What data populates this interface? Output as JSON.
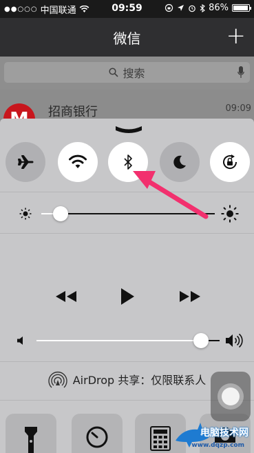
{
  "status_bar": {
    "carrier": "中国联通",
    "time": "09:59",
    "battery": "86%",
    "battery_level": 0.86
  },
  "wechat": {
    "title": "微信",
    "add_label": "+",
    "search_placeholder": "搜索",
    "chat_name": "招商银行",
    "chat_time": "09:09"
  },
  "control_center": {
    "toggles": [
      {
        "name": "airplane-mode",
        "icon": "airplane-icon",
        "on": false
      },
      {
        "name": "wifi",
        "icon": "wifi-icon",
        "on": true
      },
      {
        "name": "bluetooth",
        "icon": "bluetooth-icon",
        "on": true
      },
      {
        "name": "do-not-disturb",
        "icon": "moon-icon",
        "on": false
      },
      {
        "name": "rotation-lock",
        "icon": "rotation-lock-icon",
        "on": true
      }
    ],
    "brightness_level": 0.11,
    "volume_level": 0.9,
    "airdrop": {
      "label": "AirDrop 共享：仅限联系人"
    },
    "tools": [
      "flashlight-icon",
      "timer-icon",
      "calculator-icon",
      "camera-icon"
    ]
  },
  "watermark": {
    "line1": "电脑技术网",
    "line2": "www.dqzp.com"
  },
  "colors": {
    "cc_background": "#c7c7c9",
    "toggle_on": "#ffffff",
    "toggle_off": "#b0b0b3",
    "arrow": "#f2306e",
    "wechat_header": "#2f2f31"
  }
}
